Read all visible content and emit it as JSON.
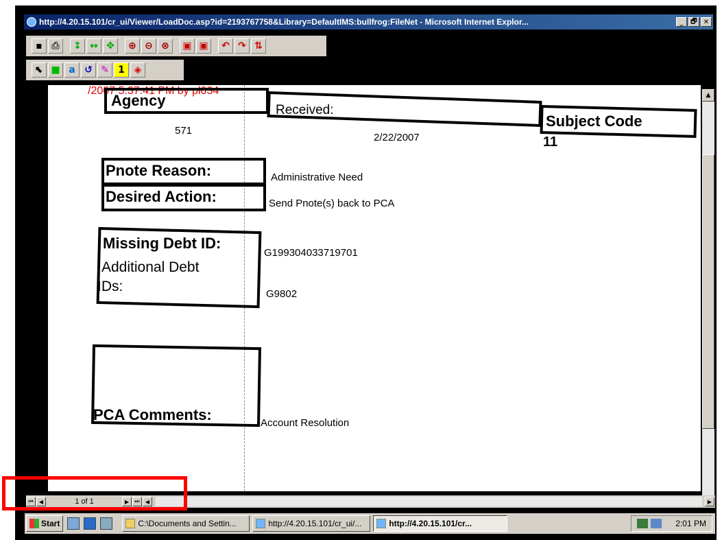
{
  "window": {
    "title": "http://4.20.15.101/cr_ui/Viewer/LoadDoc.asp?id=2193767758&Library=DefaultIMS:bullfrog:FileNet - Microsoft Internet Explor...",
    "controls": {
      "minimize": "_",
      "maximize": "🗗",
      "close": "✕"
    }
  },
  "toolbar1": {
    "icons": [
      "save-icon",
      "print-icon",
      "fit-height-icon",
      "fit-width-icon",
      "fit-page-icon",
      "zoom-in-icon",
      "zoom-out-icon",
      "zoom-area-icon",
      "single-page-icon",
      "double-page-icon",
      "rotate-left-icon",
      "rotate-right-icon",
      "flip-icon"
    ]
  },
  "toolbar2": {
    "icons": [
      "select-icon",
      "highlight-icon",
      "text-note-icon",
      "undo-icon",
      "pen-icon",
      "sticky-note-icon",
      "stamp-icon"
    ]
  },
  "document": {
    "stamp": "/2007 5:37:41 PM by pl034",
    "agency_label": "Agency",
    "agency_value": "571",
    "received_label": "Received:",
    "received_value": "2/22/2007",
    "subject_code_label": "Subject Code",
    "subject_code_value": "11",
    "pnote_reason_label": "Pnote Reason:",
    "pnote_reason_value": "Administrative Need",
    "desired_action_label": "Desired Action:",
    "desired_action_value": "Send Pnote(s) back to PCA",
    "missing_debt_label": "Missing Debt ID:",
    "missing_debt_value": "G199304033719701",
    "additional_debt_label_1": "Additional Debt",
    "additional_debt_label_2": "IDs:",
    "additional_debt_value": "G9802",
    "pca_comments_label": "PCA Comments:",
    "pca_comments_value": "Account Resolution"
  },
  "pager": {
    "indicator": "1 of 1"
  },
  "taskbar": {
    "start_label": "Start",
    "tasks": [
      {
        "label": "C:\\Documents and Settin..."
      },
      {
        "label": "http://4.20.15.101/cr_ui/..."
      },
      {
        "label": "http://4.20.15.101/cr..."
      }
    ],
    "clock": "2:01 PM"
  },
  "colors": {
    "title_bar": "#0a246a",
    "highlight_box": "#ff0000",
    "stamp": "#e00000"
  }
}
